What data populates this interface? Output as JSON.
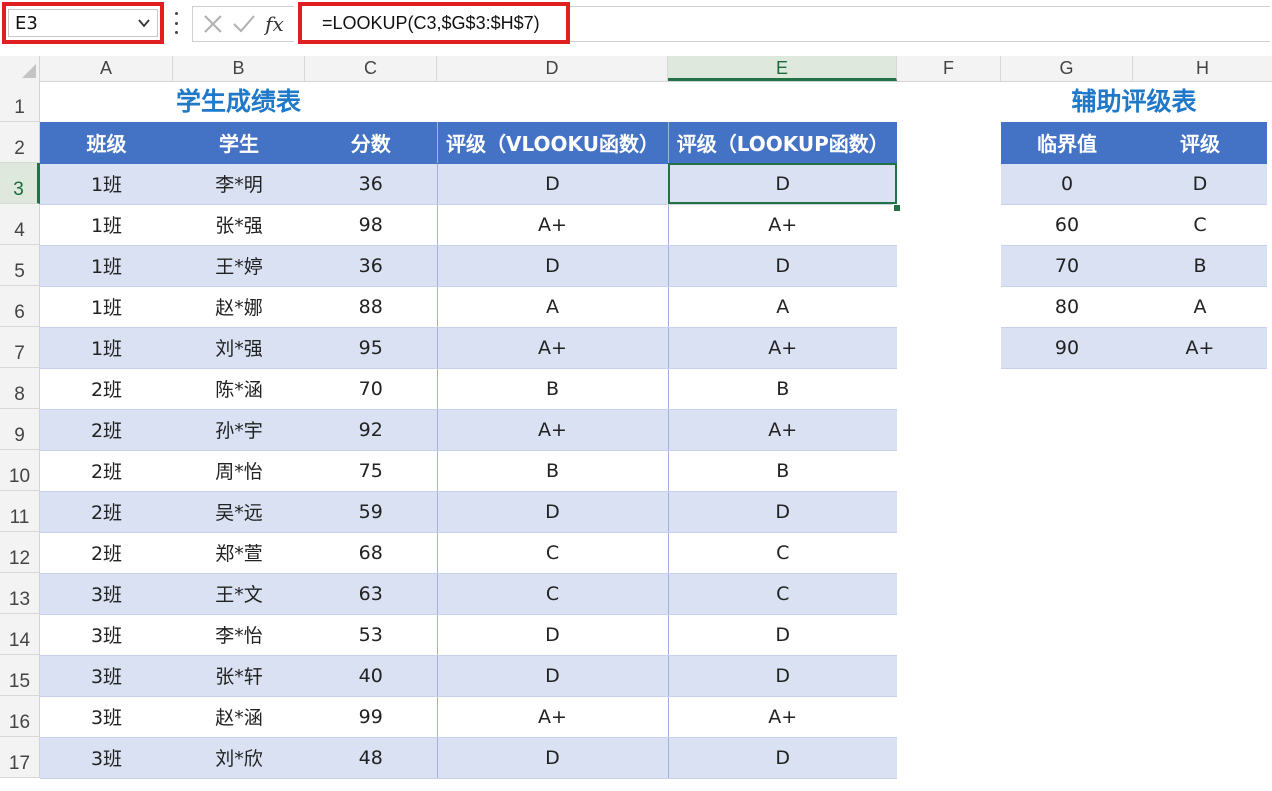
{
  "formula_bar": {
    "name_box": "E3",
    "fx": "fx",
    "formula": "=LOOKUP(C3,$G$3:$H$7)"
  },
  "columns": [
    "A",
    "B",
    "C",
    "D",
    "E",
    "F",
    "G",
    "H"
  ],
  "rows": [
    "1",
    "2",
    "3",
    "4",
    "5",
    "6",
    "7",
    "8",
    "9",
    "10",
    "11",
    "12",
    "13",
    "14",
    "15",
    "16",
    "17"
  ],
  "active_cell": {
    "column": "E",
    "row": "3"
  },
  "main_table": {
    "title": "学生成绩表",
    "headers": [
      "班级",
      "学生",
      "分数",
      "评级（VLOOKU函数）",
      "评级（LOOKUP函数）"
    ],
    "rows": [
      [
        "1班",
        "李*明",
        "36",
        "D",
        "D"
      ],
      [
        "1班",
        "张*强",
        "98",
        "A+",
        "A+"
      ],
      [
        "1班",
        "王*婷",
        "36",
        "D",
        "D"
      ],
      [
        "1班",
        "赵*娜",
        "88",
        "A",
        "A"
      ],
      [
        "1班",
        "刘*强",
        "95",
        "A+",
        "A+"
      ],
      [
        "2班",
        "陈*涵",
        "70",
        "B",
        "B"
      ],
      [
        "2班",
        "孙*宇",
        "92",
        "A+",
        "A+"
      ],
      [
        "2班",
        "周*怡",
        "75",
        "B",
        "B"
      ],
      [
        "2班",
        "吴*远",
        "59",
        "D",
        "D"
      ],
      [
        "2班",
        "郑*萱",
        "68",
        "C",
        "C"
      ],
      [
        "3班",
        "王*文",
        "63",
        "C",
        "C"
      ],
      [
        "3班",
        "李*怡",
        "53",
        "D",
        "D"
      ],
      [
        "3班",
        "张*轩",
        "40",
        "D",
        "D"
      ],
      [
        "3班",
        "赵*涵",
        "99",
        "A+",
        "A+"
      ],
      [
        "3班",
        "刘*欣",
        "48",
        "D",
        "D"
      ]
    ]
  },
  "aux_table": {
    "title": "辅助评级表",
    "headers": [
      "临界值",
      "评级"
    ],
    "rows": [
      [
        "0",
        "D"
      ],
      [
        "60",
        "C"
      ],
      [
        "70",
        "B"
      ],
      [
        "80",
        "A"
      ],
      [
        "90",
        "A+"
      ]
    ]
  },
  "colors": {
    "header_fill": "#4472c4",
    "band_fill": "#d9e1f2",
    "title_text": "#1f78c8",
    "highlight_border": "#e02020",
    "selection": "#217346"
  }
}
